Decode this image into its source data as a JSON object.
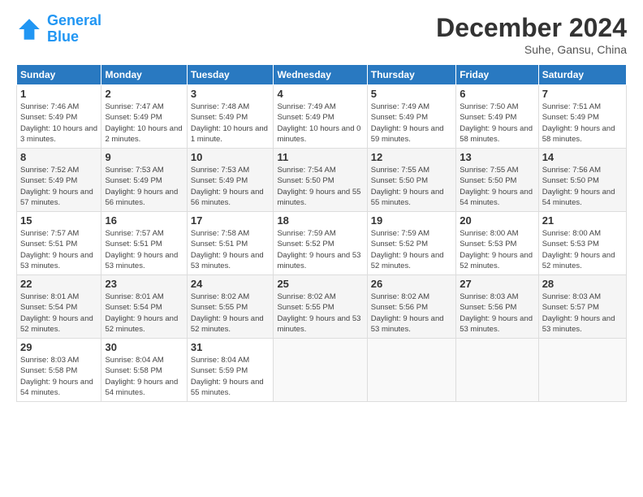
{
  "header": {
    "logo_line1": "General",
    "logo_line2": "Blue",
    "month": "December 2024",
    "location": "Suhe, Gansu, China"
  },
  "days_of_week": [
    "Sunday",
    "Monday",
    "Tuesday",
    "Wednesday",
    "Thursday",
    "Friday",
    "Saturday"
  ],
  "weeks": [
    [
      {
        "day": "1",
        "sunrise": "Sunrise: 7:46 AM",
        "sunset": "Sunset: 5:49 PM",
        "daylight": "Daylight: 10 hours and 3 minutes."
      },
      {
        "day": "2",
        "sunrise": "Sunrise: 7:47 AM",
        "sunset": "Sunset: 5:49 PM",
        "daylight": "Daylight: 10 hours and 2 minutes."
      },
      {
        "day": "3",
        "sunrise": "Sunrise: 7:48 AM",
        "sunset": "Sunset: 5:49 PM",
        "daylight": "Daylight: 10 hours and 1 minute."
      },
      {
        "day": "4",
        "sunrise": "Sunrise: 7:49 AM",
        "sunset": "Sunset: 5:49 PM",
        "daylight": "Daylight: 10 hours and 0 minutes."
      },
      {
        "day": "5",
        "sunrise": "Sunrise: 7:49 AM",
        "sunset": "Sunset: 5:49 PM",
        "daylight": "Daylight: 9 hours and 59 minutes."
      },
      {
        "day": "6",
        "sunrise": "Sunrise: 7:50 AM",
        "sunset": "Sunset: 5:49 PM",
        "daylight": "Daylight: 9 hours and 58 minutes."
      },
      {
        "day": "7",
        "sunrise": "Sunrise: 7:51 AM",
        "sunset": "Sunset: 5:49 PM",
        "daylight": "Daylight: 9 hours and 58 minutes."
      }
    ],
    [
      {
        "day": "8",
        "sunrise": "Sunrise: 7:52 AM",
        "sunset": "Sunset: 5:49 PM",
        "daylight": "Daylight: 9 hours and 57 minutes."
      },
      {
        "day": "9",
        "sunrise": "Sunrise: 7:53 AM",
        "sunset": "Sunset: 5:49 PM",
        "daylight": "Daylight: 9 hours and 56 minutes."
      },
      {
        "day": "10",
        "sunrise": "Sunrise: 7:53 AM",
        "sunset": "Sunset: 5:49 PM",
        "daylight": "Daylight: 9 hours and 56 minutes."
      },
      {
        "day": "11",
        "sunrise": "Sunrise: 7:54 AM",
        "sunset": "Sunset: 5:50 PM",
        "daylight": "Daylight: 9 hours and 55 minutes."
      },
      {
        "day": "12",
        "sunrise": "Sunrise: 7:55 AM",
        "sunset": "Sunset: 5:50 PM",
        "daylight": "Daylight: 9 hours and 55 minutes."
      },
      {
        "day": "13",
        "sunrise": "Sunrise: 7:55 AM",
        "sunset": "Sunset: 5:50 PM",
        "daylight": "Daylight: 9 hours and 54 minutes."
      },
      {
        "day": "14",
        "sunrise": "Sunrise: 7:56 AM",
        "sunset": "Sunset: 5:50 PM",
        "daylight": "Daylight: 9 hours and 54 minutes."
      }
    ],
    [
      {
        "day": "15",
        "sunrise": "Sunrise: 7:57 AM",
        "sunset": "Sunset: 5:51 PM",
        "daylight": "Daylight: 9 hours and 53 minutes."
      },
      {
        "day": "16",
        "sunrise": "Sunrise: 7:57 AM",
        "sunset": "Sunset: 5:51 PM",
        "daylight": "Daylight: 9 hours and 53 minutes."
      },
      {
        "day": "17",
        "sunrise": "Sunrise: 7:58 AM",
        "sunset": "Sunset: 5:51 PM",
        "daylight": "Daylight: 9 hours and 53 minutes."
      },
      {
        "day": "18",
        "sunrise": "Sunrise: 7:59 AM",
        "sunset": "Sunset: 5:52 PM",
        "daylight": "Daylight: 9 hours and 53 minutes."
      },
      {
        "day": "19",
        "sunrise": "Sunrise: 7:59 AM",
        "sunset": "Sunset: 5:52 PM",
        "daylight": "Daylight: 9 hours and 52 minutes."
      },
      {
        "day": "20",
        "sunrise": "Sunrise: 8:00 AM",
        "sunset": "Sunset: 5:53 PM",
        "daylight": "Daylight: 9 hours and 52 minutes."
      },
      {
        "day": "21",
        "sunrise": "Sunrise: 8:00 AM",
        "sunset": "Sunset: 5:53 PM",
        "daylight": "Daylight: 9 hours and 52 minutes."
      }
    ],
    [
      {
        "day": "22",
        "sunrise": "Sunrise: 8:01 AM",
        "sunset": "Sunset: 5:54 PM",
        "daylight": "Daylight: 9 hours and 52 minutes."
      },
      {
        "day": "23",
        "sunrise": "Sunrise: 8:01 AM",
        "sunset": "Sunset: 5:54 PM",
        "daylight": "Daylight: 9 hours and 52 minutes."
      },
      {
        "day": "24",
        "sunrise": "Sunrise: 8:02 AM",
        "sunset": "Sunset: 5:55 PM",
        "daylight": "Daylight: 9 hours and 52 minutes."
      },
      {
        "day": "25",
        "sunrise": "Sunrise: 8:02 AM",
        "sunset": "Sunset: 5:55 PM",
        "daylight": "Daylight: 9 hours and 53 minutes."
      },
      {
        "day": "26",
        "sunrise": "Sunrise: 8:02 AM",
        "sunset": "Sunset: 5:56 PM",
        "daylight": "Daylight: 9 hours and 53 minutes."
      },
      {
        "day": "27",
        "sunrise": "Sunrise: 8:03 AM",
        "sunset": "Sunset: 5:56 PM",
        "daylight": "Daylight: 9 hours and 53 minutes."
      },
      {
        "day": "28",
        "sunrise": "Sunrise: 8:03 AM",
        "sunset": "Sunset: 5:57 PM",
        "daylight": "Daylight: 9 hours and 53 minutes."
      }
    ],
    [
      {
        "day": "29",
        "sunrise": "Sunrise: 8:03 AM",
        "sunset": "Sunset: 5:58 PM",
        "daylight": "Daylight: 9 hours and 54 minutes."
      },
      {
        "day": "30",
        "sunrise": "Sunrise: 8:04 AM",
        "sunset": "Sunset: 5:58 PM",
        "daylight": "Daylight: 9 hours and 54 minutes."
      },
      {
        "day": "31",
        "sunrise": "Sunrise: 8:04 AM",
        "sunset": "Sunset: 5:59 PM",
        "daylight": "Daylight: 9 hours and 55 minutes."
      },
      null,
      null,
      null,
      null
    ]
  ]
}
